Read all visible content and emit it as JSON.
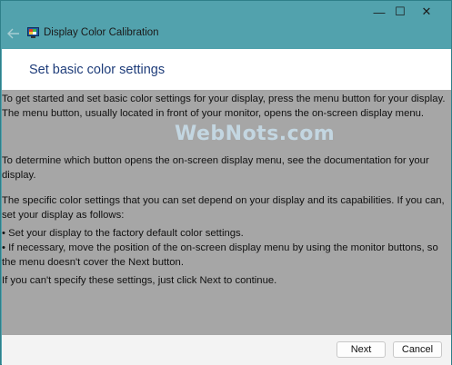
{
  "window": {
    "title": "Display Color Calibration",
    "controls": {
      "minimize": "—",
      "maximize": "☐",
      "close": "✕"
    }
  },
  "header": {
    "title": "Set basic color settings"
  },
  "content": {
    "paragraphs": [
      "To get started and set basic color settings for your display, press the menu button for your display. The menu button, usually located in front of your monitor, opens the on-screen display menu.",
      "To determine which button opens the on-screen display menu, see the documentation for your display.",
      "The specific color settings that you can set depend on your display and its capabilities. If you can, set your display as follows:",
      "• Set your display to the factory default color settings.",
      "• If necessary, move the position of the on-screen display menu by using the monitor buttons, so the menu doesn't cover the Next button.",
      "If you can't specify these settings,  just click Next to continue."
    ],
    "watermark": "WebNots.com"
  },
  "footer": {
    "next_label": "Next",
    "cancel_label": "Cancel"
  },
  "icons": {
    "back": "back-arrow-icon",
    "app": "display-color-calibration-icon"
  }
}
